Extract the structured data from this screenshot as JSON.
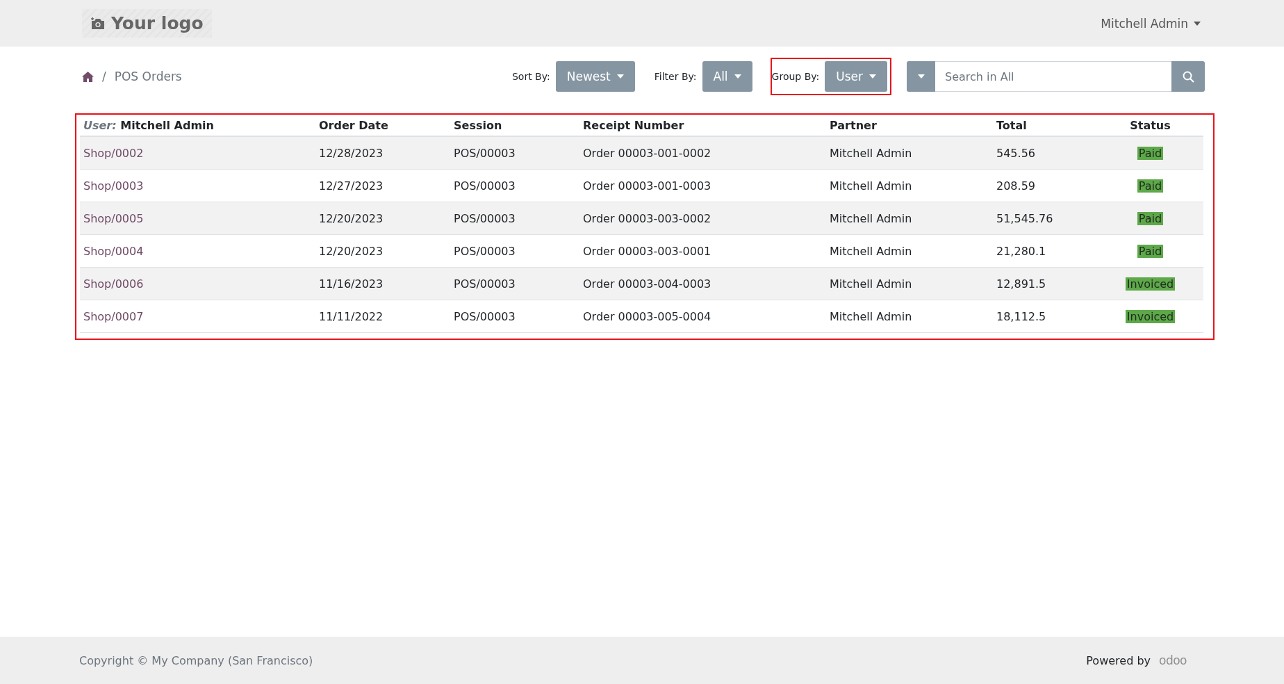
{
  "header": {
    "logo": "Your logo",
    "user_menu": "Mitchell Admin"
  },
  "breadcrumb": {
    "separator": "/",
    "current": "POS Orders"
  },
  "toolbar": {
    "sort_by": {
      "label": "Sort By:",
      "value": "Newest",
      "highlighted": false
    },
    "filter_by": {
      "label": "Filter By:",
      "value": "All",
      "highlighted": false
    },
    "group_by": {
      "label": "Group By:",
      "value": "User",
      "highlighted": true
    },
    "search": {
      "placeholder": "Search in All"
    }
  },
  "table": {
    "highlighted": true,
    "group_label": "User:",
    "group_value": "Mitchell Admin",
    "columns": [
      "Order Date",
      "Session",
      "Receipt Number",
      "Partner",
      "Total",
      "Status"
    ],
    "rows": [
      {
        "order": "Shop/0002",
        "date": "12/28/2023",
        "session": "POS/00003",
        "receipt": "Order 00003-001-0002",
        "partner": "Mitchell Admin",
        "total": "545.56",
        "status": "Paid"
      },
      {
        "order": "Shop/0003",
        "date": "12/27/2023",
        "session": "POS/00003",
        "receipt": "Order 00003-001-0003",
        "partner": "Mitchell Admin",
        "total": "208.59",
        "status": "Paid"
      },
      {
        "order": "Shop/0005",
        "date": "12/20/2023",
        "session": "POS/00003",
        "receipt": "Order 00003-003-0002",
        "partner": "Mitchell Admin",
        "total": "51,545.76",
        "status": "Paid"
      },
      {
        "order": "Shop/0004",
        "date": "12/20/2023",
        "session": "POS/00003",
        "receipt": "Order 00003-003-0001",
        "partner": "Mitchell Admin",
        "total": "21,280.1",
        "status": "Paid"
      },
      {
        "order": "Shop/0006",
        "date": "11/16/2023",
        "session": "POS/00003",
        "receipt": "Order 00003-004-0003",
        "partner": "Mitchell Admin",
        "total": "12,891.5",
        "status": "Invoiced"
      },
      {
        "order": "Shop/0007",
        "date": "11/11/2022",
        "session": "POS/00003",
        "receipt": "Order 00003-005-0004",
        "partner": "Mitchell Admin",
        "total": "18,112.5",
        "status": "Invoiced"
      }
    ]
  },
  "footer": {
    "copyright": "Copyright © My Company (San Francisco)",
    "powered_by": "Powered by",
    "brand": "odoo"
  }
}
